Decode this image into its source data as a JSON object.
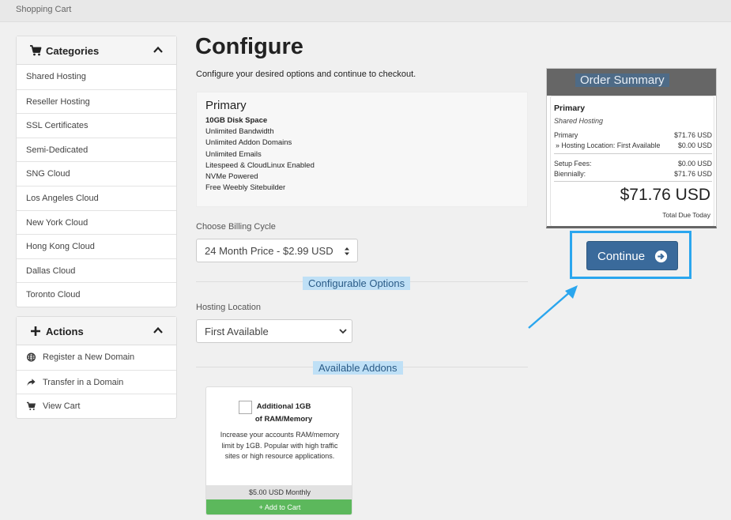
{
  "breadcrumb": "Shopping Cart",
  "sidebar": {
    "categories": {
      "title": "Categories",
      "items": [
        "Shared Hosting",
        "Reseller Hosting",
        "SSL Certificates",
        "Semi-Dedicated",
        "SNG Cloud",
        "Los Angeles Cloud",
        "New York Cloud",
        "Hong Kong Cloud",
        "Dallas Cloud",
        "Toronto Cloud"
      ]
    },
    "actions": {
      "title": "Actions",
      "items": [
        {
          "label": "Register a New Domain",
          "icon": "globe-icon"
        },
        {
          "label": "Transfer in a Domain",
          "icon": "share-arrow-icon"
        },
        {
          "label": "View Cart",
          "icon": "cart-icon"
        }
      ]
    }
  },
  "main": {
    "title": "Configure",
    "subtitle": "Configure your desired options and continue to checkout.",
    "product": {
      "name": "Primary",
      "features": [
        "10GB Disk Space",
        "Unlimited Bandwidth",
        "Unlimited Addon Domains",
        "Unlimited Emails",
        "Litespeed & CloudLinux Enabled",
        "NVMe Powered",
        "Free Weebly Sitebuilder"
      ]
    },
    "billing": {
      "label": "Choose Billing Cycle",
      "selected": "24 Month Price - $2.99 USD"
    },
    "configurable_title": "Configurable Options",
    "location": {
      "label": "Hosting Location",
      "selected": "First Available"
    },
    "addons_title": "Available Addons",
    "addon": {
      "name": "Additional 1GB of RAM/Memory",
      "description": "Increase your accounts RAM/memory limit by 1GB. Popular with high traffic sites or high resource applications.",
      "price": "$5.00 USD Monthly",
      "add_label": "Add to Cart"
    }
  },
  "summary": {
    "title": "Order Summary",
    "product_name": "Primary",
    "product_group": "Shared Hosting",
    "lines": [
      {
        "label": "Primary",
        "value": "$71.76 USD"
      },
      {
        "label": "» Hosting Location: First Available",
        "value": "$0.00 USD"
      }
    ],
    "fees": [
      {
        "label": "Setup Fees:",
        "value": "$0.00 USD"
      },
      {
        "label": "Biennially:",
        "value": "$71.76 USD"
      }
    ],
    "total": "$71.76 USD",
    "total_label": "Total Due Today"
  },
  "continue_label": "Continue",
  "colors": {
    "primary_button": "#3a6a9b",
    "highlight": "#2aa6ee",
    "add_to_cart": "#5cb85c",
    "summary_header": "#666666"
  }
}
